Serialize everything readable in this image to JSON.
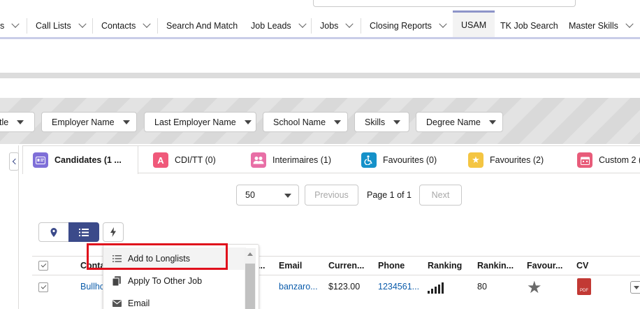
{
  "nav": {
    "items": [
      {
        "label": "s",
        "dropdown": true
      },
      {
        "label": "Call Lists",
        "dropdown": true
      },
      {
        "label": "Contacts",
        "dropdown": true
      },
      {
        "label": "Search And Match",
        "dropdown": false
      },
      {
        "label": "Job Leads",
        "dropdown": true
      },
      {
        "label": "Jobs",
        "dropdown": true
      },
      {
        "label": "Closing Reports",
        "dropdown": true
      },
      {
        "label": "USAM",
        "dropdown": false,
        "active": true
      },
      {
        "label": "TK Job Search",
        "dropdown": false
      },
      {
        "label": "Master Skills",
        "dropdown": true
      }
    ]
  },
  "filters": [
    "tle",
    "Employer Name",
    "Last Employer Name",
    "School Name",
    "Skills",
    "Degree Name"
  ],
  "tabs": [
    {
      "label": "Candidates (1 ...",
      "icon": "contact-card-icon",
      "color": "#7f6fd8",
      "active": true
    },
    {
      "label": "CDI/TT (0)",
      "icon": "letter-a-icon",
      "color": "#f0597a"
    },
    {
      "label": "Interimaires (1)",
      "icon": "people-icon",
      "color": "#e86fa6"
    },
    {
      "label": "Favourites (0)",
      "icon": "accessibility-icon",
      "color": "#1591c9"
    },
    {
      "label": "Favourites (2)",
      "icon": "star-icon",
      "color": "#f4c542"
    },
    {
      "label": "Custom 2 (0",
      "icon": "calendar-icon",
      "color": "#e85c7a"
    }
  ],
  "pager": {
    "page_size": "50",
    "previous": "Previous",
    "page_label": "Page 1 of 1",
    "next": "Next"
  },
  "menu": {
    "items": [
      {
        "label": "Add to Longlists",
        "icon": "list-icon"
      },
      {
        "label": "Apply To Other Job",
        "icon": "copy-icon"
      },
      {
        "label": "Email",
        "icon": "email-icon"
      }
    ]
  },
  "table": {
    "headers": {
      "contact": "Conta",
      "truncated": "...",
      "email": "Email",
      "current": "Curren...",
      "phone": "Phone",
      "ranking": "Ranking",
      "ranking2": "Rankin...",
      "favourite": "Favour...",
      "cv": "CV"
    },
    "row": {
      "contact": "Bullhc",
      "email": "banzaro...",
      "current": "$123.00",
      "phone": "1234561...",
      "ranking2": "80",
      "cv_badge": "PDF"
    }
  },
  "colors": {
    "accent": "#3b4a8a",
    "link": "#0b5cab",
    "highlight": "#e0101c",
    "cv": "#c23934"
  }
}
